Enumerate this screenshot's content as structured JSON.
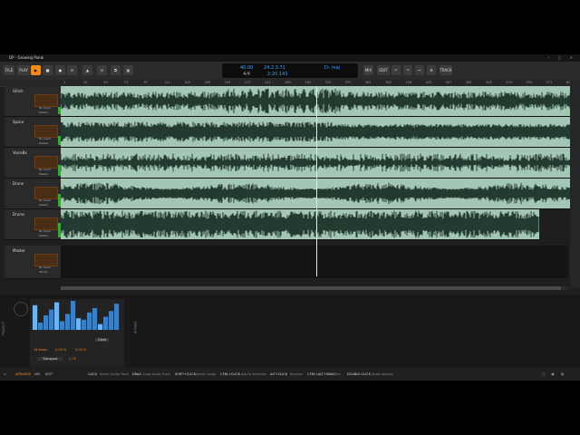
{
  "window": {
    "title": "DP - Growing Pains",
    "close": "×"
  },
  "toolbar": {
    "file_label": "FILE",
    "play_label": "PLAY",
    "edit_label": "EDIT",
    "mix_label": "MIX",
    "track_label": "TRACK"
  },
  "transport": {
    "tempo": "40.00",
    "time_signature": "4/4",
    "position_bars": "24.2.3.71",
    "position_time": "2:20.143",
    "key": "D♭ maj",
    "key_label": "O♭ maj"
  },
  "ruler": {
    "marks": [
      "1",
      "5",
      "9",
      "13",
      "17",
      "21",
      "25",
      "29",
      "33",
      "37",
      "41",
      "45",
      "49",
      "53",
      "57",
      "61",
      "65",
      "69",
      "73",
      "77",
      "81",
      "85",
      "89",
      "93",
      "97",
      "101",
      "105",
      "109",
      "113",
      "117",
      "121",
      "125",
      "129",
      "133",
      "137",
      "141",
      "145",
      "149",
      "153",
      "157",
      "161",
      "165",
      "169",
      "173",
      "177",
      "181",
      "185",
      "189",
      "193",
      "197",
      "201",
      "205",
      "209",
      "213",
      "217",
      "221",
      "225",
      "229",
      "233",
      "237",
      "241",
      "245",
      "249",
      "253",
      "257",
      "261",
      "265",
      "269",
      "273",
      "277",
      "281",
      "285",
      "289",
      "293",
      "297",
      "301",
      "305",
      "309",
      "313",
      "317",
      "321",
      "325",
      "329",
      "333",
      "337",
      "341",
      "345",
      "349",
      "353",
      "357",
      "361",
      "365",
      "369",
      "373",
      "377",
      "381",
      "385",
      "389",
      "393",
      "397",
      "401",
      "405",
      "409",
      "413",
      "417",
      "421",
      "425",
      "429",
      "433",
      "437",
      "441",
      "445",
      "449",
      "453",
      "457",
      "461",
      "465",
      "469",
      "473",
      "477",
      "481",
      "485",
      "489",
      "493",
      "497",
      "501",
      "505",
      "509",
      "513",
      "517",
      "521",
      "525",
      "529",
      "533",
      "537",
      "541",
      "545",
      "549",
      "553",
      "557",
      "561",
      "565",
      "569",
      "573",
      "577",
      "581",
      "585",
      "589",
      "593",
      "597",
      "601",
      "605",
      "609",
      "613",
      "617"
    ]
  },
  "tracks": [
    {
      "name": "Glitch",
      "input": "No Input",
      "output": "Master",
      "m": "M",
      "s": "S",
      "o": "O"
    },
    {
      "name": "Space",
      "input": "No Input",
      "output": "Master",
      "m": "M",
      "s": "S",
      "o": "O"
    },
    {
      "name": "VoiceBx",
      "input": "No Input",
      "output": "Master",
      "m": "M",
      "s": "S",
      "o": "O"
    },
    {
      "name": "Drone",
      "input": "No Input",
      "output": "Master",
      "m": "M",
      "s": "S",
      "o": "O"
    },
    {
      "name": "Drums",
      "input": "No Input",
      "output": "Master",
      "m": "M",
      "s": "S",
      "o": "O"
    }
  ],
  "master": {
    "name": "Master",
    "input": "No Input",
    "output": "Studio",
    "m": "M",
    "s": "S",
    "o": "O"
  },
  "bottom_panel": {
    "side_label": "PROJECT",
    "device_side_label": "DEVICE",
    "step_count": "16 steps",
    "percent_a": "0.00 %",
    "percent_b": "0.00 %",
    "clear_label": "Clear",
    "transport_label": "Transport",
    "value": "1.70",
    "bars": [
      0.85,
      0.25,
      0.5,
      0.7,
      0.95,
      0.3,
      0.55,
      1.0,
      0.4,
      0.35,
      0.6,
      0.75,
      0.2,
      0.45,
      0.65,
      0.9
    ]
  },
  "statusbar": {
    "arrange": "ARRANGE",
    "mix": "MIX",
    "edit": "EDIT",
    "click": "CLICK",
    "click_desc": "Select Audio Track",
    "drag": "DRAG",
    "drag_desc": "Drag Audio Track",
    "shift_click": "SHIFT+CLICK",
    "shift_click_desc": "Select range",
    "ctrl_click": "CTRL+CLICK",
    "ctrl_click_desc": "Add to selection",
    "alt_click": "ALT+CLICK",
    "alt_click_desc": "Rename",
    "ctrl_alt_drag": "CTRL+ALT+DRAG",
    "ctrl_alt_drag_desc": "Pan",
    "double_click": "DOUBLE-CLICK",
    "double_click_desc": "Show devices"
  }
}
